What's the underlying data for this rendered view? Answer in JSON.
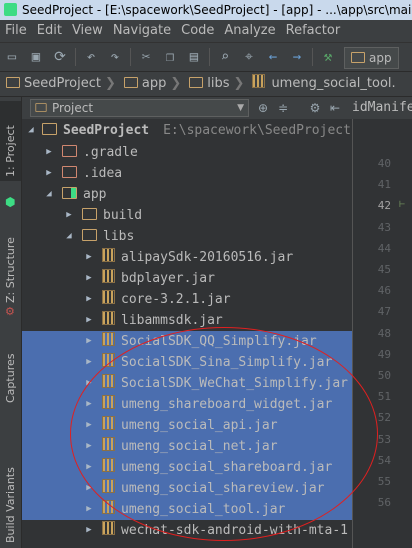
{
  "window": {
    "title": "SeedProject - [E:\\spacework\\SeedProject] - [app] - ...\\app\\src\\main\\"
  },
  "menu": [
    "File",
    "Edit",
    "View",
    "Navigate",
    "Code",
    "Analyze",
    "Refactor"
  ],
  "toolbar": {
    "run_config": "app"
  },
  "breadcrumbs": [
    "SeedProject",
    "app",
    "libs",
    "umeng_social_tool."
  ],
  "side_tabs": {
    "project": "1: Project",
    "structure": "Z: Structure",
    "captures": "Captures",
    "build_variants": "Build Variants"
  },
  "panel": {
    "view_mode": "Project"
  },
  "editor_tab": "idManife",
  "tree": {
    "root": {
      "name": "SeedProject",
      "path": "E:\\spacework\\SeedProject"
    },
    "items": [
      {
        "name": ".gradle"
      },
      {
        "name": ".idea"
      },
      {
        "name": "app"
      },
      {
        "name": "build"
      },
      {
        "name": "libs"
      },
      {
        "name": "alipaySdk-20160516.jar"
      },
      {
        "name": "bdplayer.jar"
      },
      {
        "name": "core-3.2.1.jar"
      },
      {
        "name": "libammsdk.jar"
      },
      {
        "name": "SocialSDK_QQ_Simplify.jar"
      },
      {
        "name": "SocialSDK_Sina_Simplify.jar"
      },
      {
        "name": "SocialSDK_WeChat_Simplify.jar"
      },
      {
        "name": "umeng_shareboard_widget.jar"
      },
      {
        "name": "umeng_social_api.jar"
      },
      {
        "name": "umeng_social_net.jar"
      },
      {
        "name": "umeng_social_shareboard.jar"
      },
      {
        "name": "umeng_social_shareview.jar"
      },
      {
        "name": "umeng_social_tool.jar"
      },
      {
        "name": "wechat-sdk-android-with-mta-1"
      }
    ]
  },
  "line_numbers": [
    "40",
    "41",
    "42",
    "43",
    "44",
    "45",
    "46",
    "47",
    "48",
    "49",
    "50",
    "51",
    "52",
    "53",
    "54",
    "55",
    "56"
  ],
  "colors": {
    "selection": "#4b6eaf",
    "annotation": "#e02020"
  }
}
